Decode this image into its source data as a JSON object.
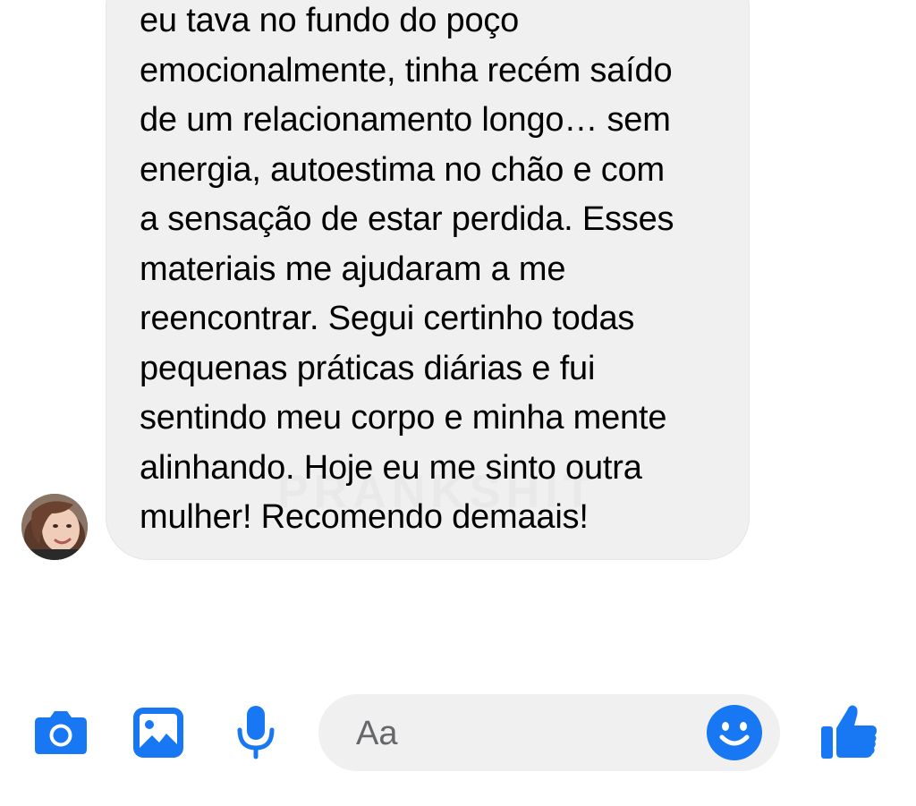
{
  "message": {
    "lines": [
      "eu tava no fundo do poço",
      "emocionalmente, tinha recém saído",
      "de um relacionamento longo… sem",
      "energia, autoestima no chão e com",
      "a sensação de estar perdida. Esses",
      "materiais me ajudaram a me",
      "reencontrar. Segui certinho todas",
      "pequenas práticas diárias e fui",
      "sentindo meu corpo e minha mente",
      "alinhando. Hoje eu me sinto outra",
      "mulher! Recomendo demaais!"
    ],
    "watermark": "PRANKSHIT"
  },
  "composer": {
    "placeholder": "Aa",
    "icons": [
      "camera-icon",
      "gallery-icon",
      "microphone-icon",
      "emoji-icon",
      "thumbs-up-icon"
    ]
  },
  "colors": {
    "accent": "#1877f2",
    "bubble_bg": "#f0f0f0",
    "input_bg": "#f0f0f0",
    "placeholder": "#65676b"
  }
}
